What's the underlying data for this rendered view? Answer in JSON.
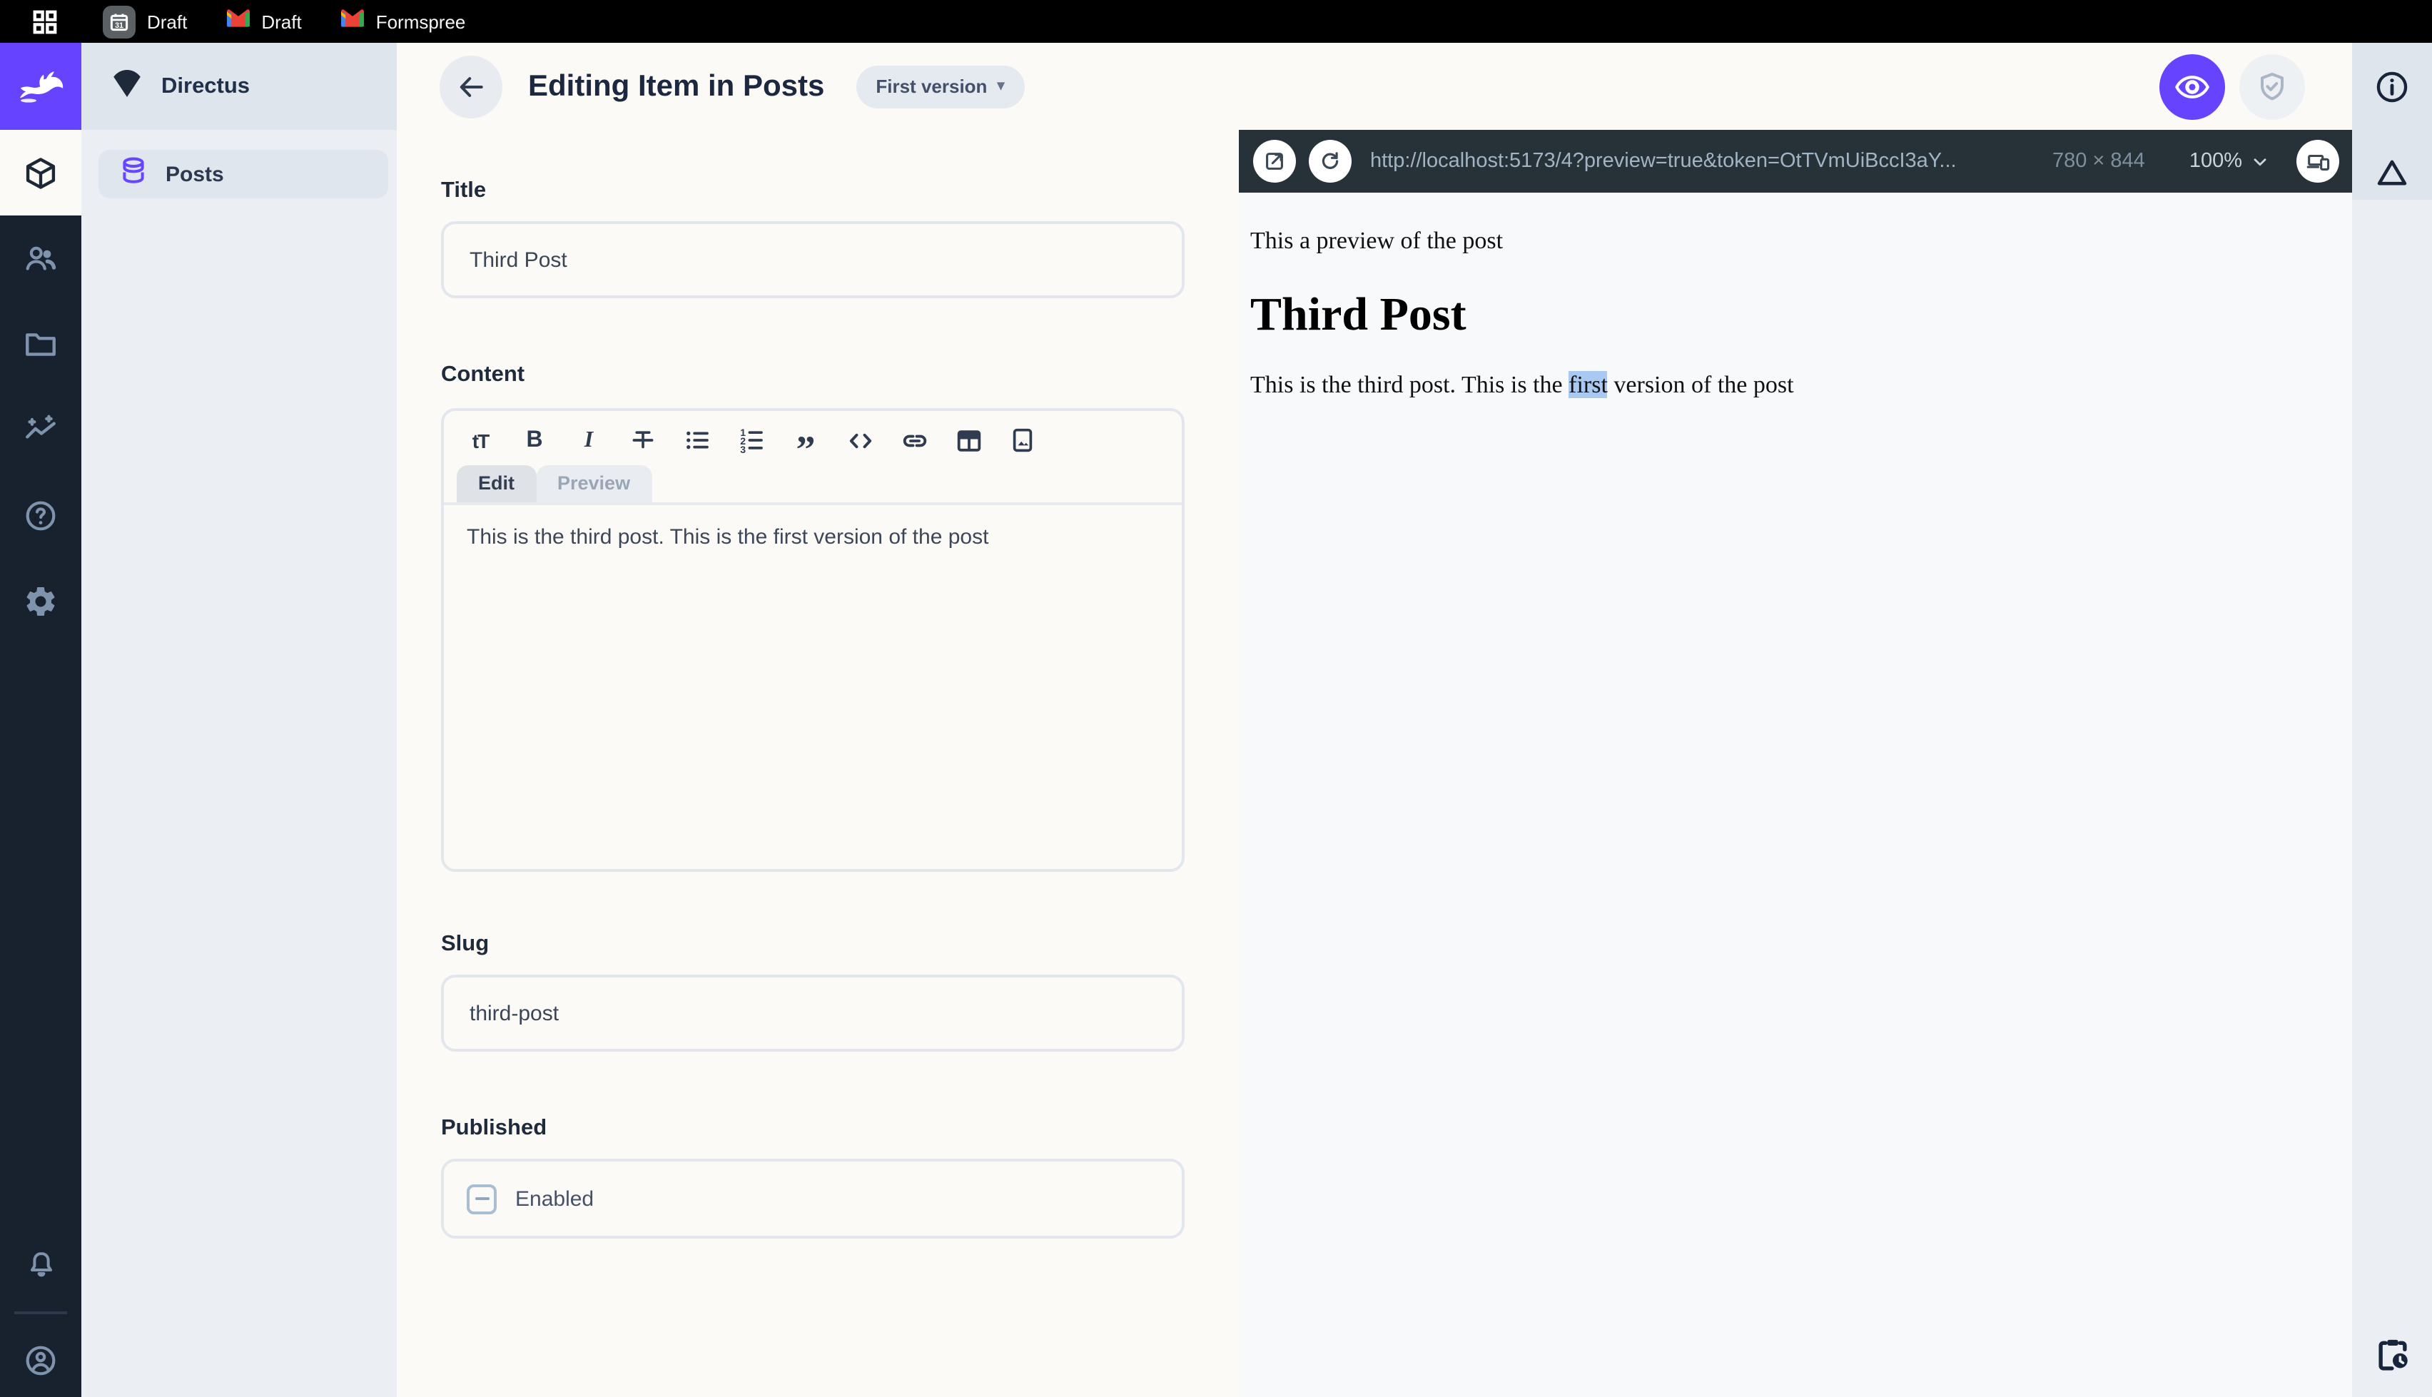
{
  "browser": {
    "tabs": [
      {
        "label": "Draft",
        "favicon": "calendar-icon"
      },
      {
        "label": "Draft",
        "favicon": "gmail-icon"
      },
      {
        "label": "Formspree",
        "favicon": "gmail-icon"
      }
    ]
  },
  "module_bar": {
    "modules": [
      "content",
      "users",
      "files",
      "insights",
      "help",
      "settings"
    ],
    "active_module": "content",
    "bottom": [
      "notifications",
      "user"
    ]
  },
  "nav": {
    "project": "Directus",
    "items": [
      {
        "label": "Posts",
        "icon": "database-icon"
      }
    ]
  },
  "header": {
    "title": "Editing Item in Posts",
    "version": "First version",
    "version_caret": "▾"
  },
  "form": {
    "title": {
      "label": "Title",
      "value": "Third Post"
    },
    "content": {
      "label": "Content",
      "toolbar": [
        "heading",
        "bold",
        "italic",
        "strikethrough",
        "bulleted-list",
        "numbered-list",
        "quote",
        "code",
        "link",
        "table",
        "image"
      ],
      "tabs": [
        {
          "label": "Edit"
        },
        {
          "label": "Preview"
        }
      ],
      "active_tab": "Edit",
      "value": "This is the third post. This is the first version of the post"
    },
    "slug": {
      "label": "Slug",
      "value": "third-post"
    },
    "published": {
      "label": "Published",
      "checkbox_label": "Enabled",
      "checkbox_state": "indeterminate"
    }
  },
  "preview": {
    "url": "http://localhost:5173/4?preview=true&token=OtTVmUiBccI3aY...",
    "dimensions": "780 × 844",
    "zoom": "100%",
    "content": {
      "intro": "This a preview of the post",
      "heading": "Third Post",
      "body_before": "This is the third post. This is the ",
      "body_highlight": "first",
      "body_after": " version of the post"
    }
  },
  "glyphs": {
    "heading": "tT",
    "bold": "B",
    "italic": "I",
    "quote": "”"
  },
  "colors": {
    "accent_purple": "#6644ff",
    "module_bar_bg": "#18222f",
    "preview_toolbar_bg": "#263238",
    "selection_highlight": "#a9c9f2",
    "sidebar_bg": "#ebeef2",
    "page_bg": "#fbfaf6"
  }
}
